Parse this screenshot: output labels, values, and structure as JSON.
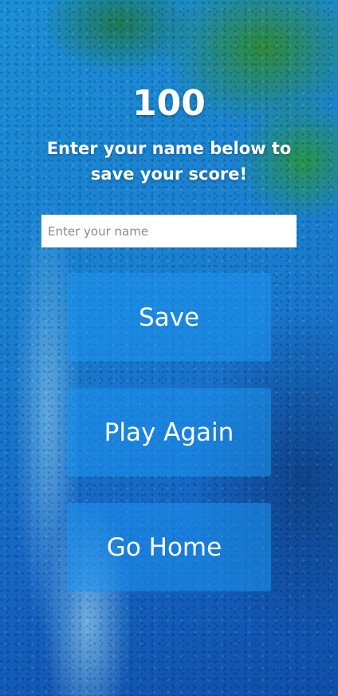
{
  "score": "100",
  "prompt": "Enter your name below to save your score!",
  "name_input": {
    "value": "",
    "placeholder": "Enter your name"
  },
  "buttons": {
    "save": "Save",
    "play_again": "Play Again",
    "go_home": "Go Home"
  },
  "colors": {
    "text": "#ffffff",
    "button_background": "rgba(30,150,240,0.55)",
    "input_background": "#ffffff"
  }
}
